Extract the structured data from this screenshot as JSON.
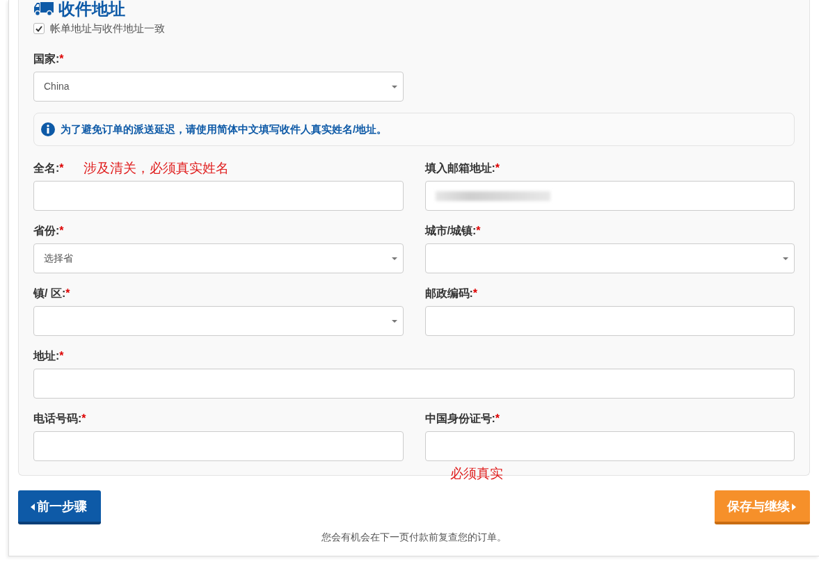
{
  "section": {
    "title": "收件地址"
  },
  "same_address": {
    "label": "帐单地址与收件地址一致",
    "checked": true
  },
  "country": {
    "label": "国家:",
    "mark": "*",
    "kind": "select",
    "value": "China"
  },
  "notice": "为了避免订单的派送延迟，请使用简体中文填写收件人真实姓名/地址。",
  "rows": [
    [
      {
        "label": "全名:",
        "mark": "*",
        "kind": "text",
        "annotation": {
          "text": "涉及清关，必须真实姓名",
          "kind": "beside"
        }
      },
      {
        "label": "填入邮箱地址:",
        "mark": "*",
        "kind": "redacted"
      }
    ],
    [
      {
        "label": "省份:",
        "mark": "*",
        "kind": "select",
        "value": "选择省"
      },
      {
        "label": "城市/城镇:",
        "mark": "*",
        "kind": "select"
      }
    ],
    [
      {
        "label": "镇/ 区:",
        "mark": "*",
        "kind": "select"
      },
      {
        "label": "邮政编码:",
        "mark": "*",
        "kind": "text"
      }
    ],
    [
      {
        "label": "地址:",
        "mark": "*",
        "kind": "text"
      }
    ],
    [
      {
        "label": "电话号码:",
        "mark": "*",
        "kind": "text"
      },
      {
        "label": "中国身份证号:",
        "mark": "*",
        "kind": "text",
        "annotation": {
          "text": "必须真实",
          "kind": "below"
        }
      }
    ]
  ],
  "buttons": [
    {
      "label": "前一步骤",
      "kind": "back"
    },
    {
      "label": "保存与继续",
      "kind": "next"
    }
  ],
  "footer_note": "您会有机会在下一页付款前复查您的订单。"
}
